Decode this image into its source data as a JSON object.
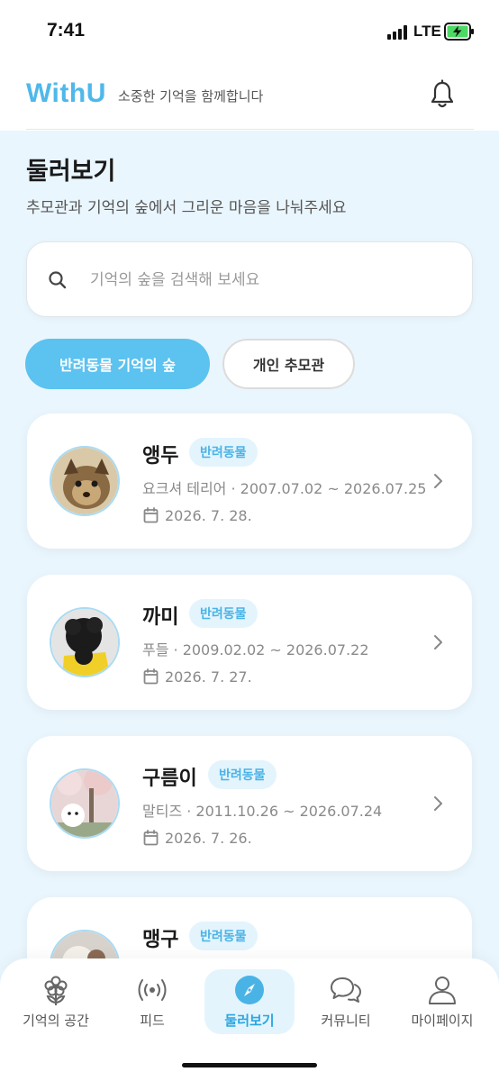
{
  "status_bar": {
    "time": "7:41",
    "network": "LTE"
  },
  "header": {
    "logo": "WithU",
    "tagline": "소중한 기억을 함께합니다"
  },
  "page": {
    "title": "둘러보기",
    "subtitle": "추모관과 기억의 숲에서 그리운 마음을 나눠주세요"
  },
  "search": {
    "placeholder": "기억의 숲을 검색해 보세요"
  },
  "tabs": [
    {
      "label": "반려동물 기억의 숲",
      "active": true
    },
    {
      "label": "개인 추모관",
      "active": false
    }
  ],
  "cards": [
    {
      "name": "앵두",
      "badge": "반려동물",
      "info": "요크셔 테리어 · 2007.07.02 ~ 2026.07.25",
      "date": "2026. 7. 28."
    },
    {
      "name": "까미",
      "badge": "반려동물",
      "info": "푸들 · 2009.02.02 ~ 2026.07.22",
      "date": "2026. 7. 27."
    },
    {
      "name": "구름이",
      "badge": "반려동물",
      "info": "말티즈 · 2011.10.26 ~ 2026.07.24",
      "date": "2026. 7. 26."
    },
    {
      "name": "맹구",
      "badge": "반려동물",
      "info": "",
      "date": ""
    }
  ],
  "nav": [
    {
      "label": "기억의 공간",
      "icon": "flower-icon",
      "active": false
    },
    {
      "label": "피드",
      "icon": "broadcast-icon",
      "active": false
    },
    {
      "label": "둘러보기",
      "icon": "compass-icon",
      "active": true
    },
    {
      "label": "커뮤니티",
      "icon": "chat-bubbles-icon",
      "active": false
    },
    {
      "label": "마이페이지",
      "icon": "user-icon",
      "active": false
    }
  ],
  "colors": {
    "accent": "#5cc2ef",
    "logo": "#4fb8ea",
    "background": "#eaf6fd",
    "badge_bg": "#e3f4fd"
  }
}
